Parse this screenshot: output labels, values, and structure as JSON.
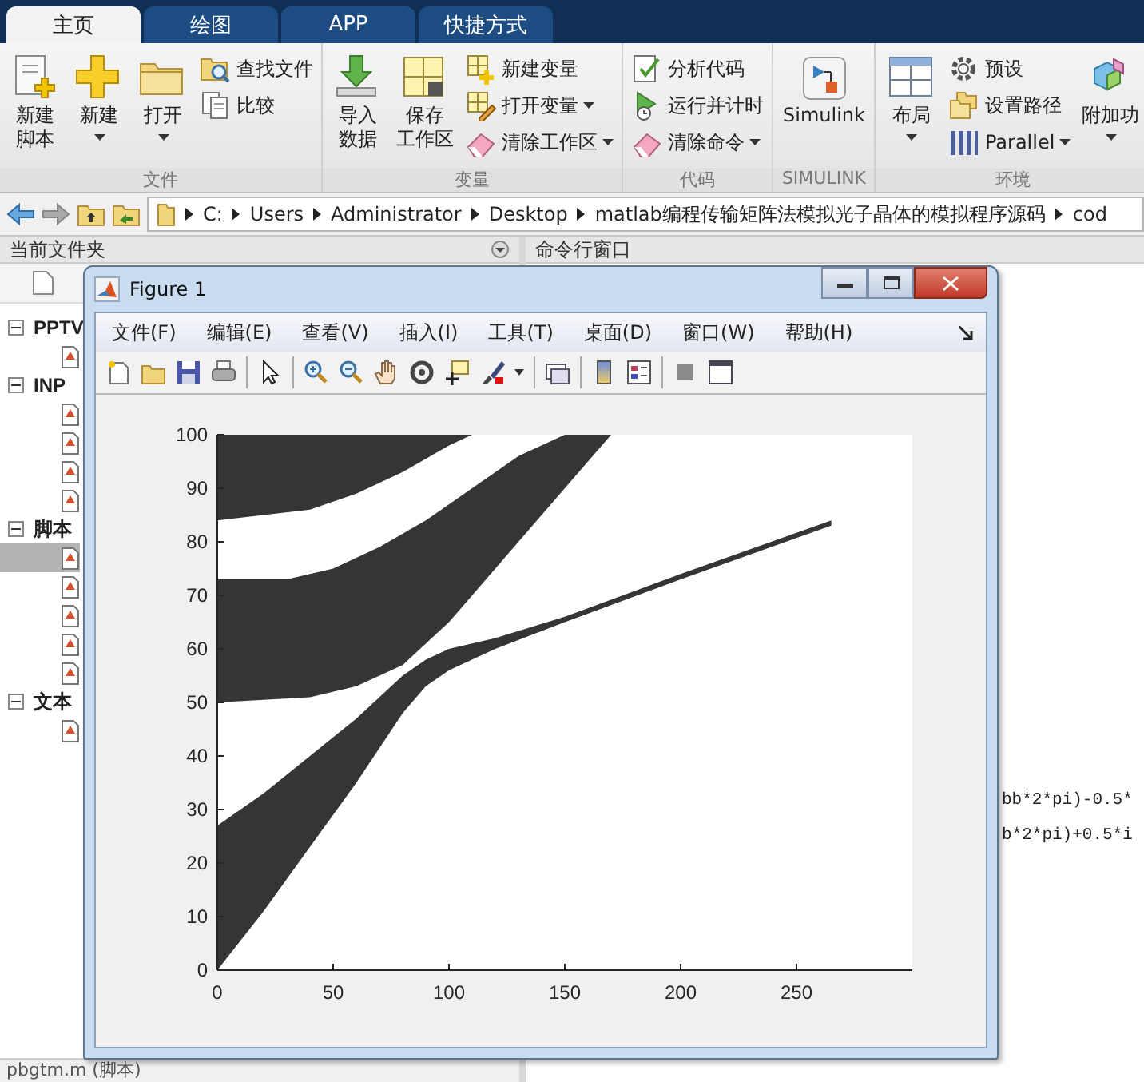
{
  "tabs": [
    {
      "label": "主页",
      "selected": true
    },
    {
      "label": "绘图",
      "selected": false
    },
    {
      "label": "APP",
      "selected": false
    },
    {
      "label": "快捷方式",
      "selected": false
    }
  ],
  "toolstrip": {
    "groups": [
      {
        "label": "文件",
        "items": [
          {
            "kind": "large",
            "lines": [
              "新建",
              "脚本"
            ],
            "dropdown": false
          },
          {
            "kind": "large",
            "lines": [
              "新建"
            ],
            "dropdown": true
          },
          {
            "kind": "large",
            "lines": [
              "打开"
            ],
            "dropdown": true
          },
          {
            "kind": "small",
            "lines": [
              "查找文件"
            ],
            "dropdown": false
          },
          {
            "kind": "small",
            "lines": [
              "比较"
            ],
            "dropdown": false
          }
        ]
      },
      {
        "label": "变量",
        "items": [
          {
            "kind": "large",
            "lines": [
              "导入",
              "数据"
            ],
            "dropdown": false
          },
          {
            "kind": "large",
            "lines": [
              "保存",
              "工作区"
            ],
            "dropdown": false
          },
          {
            "kind": "small",
            "lines": [
              "新建变量"
            ],
            "dropdown": false
          },
          {
            "kind": "small",
            "lines": [
              "打开变量"
            ],
            "dropdown": true
          },
          {
            "kind": "small",
            "lines": [
              "清除工作区"
            ],
            "dropdown": true
          }
        ]
      },
      {
        "label": "代码",
        "items": [
          {
            "kind": "small",
            "lines": [
              "分析代码"
            ],
            "dropdown": false
          },
          {
            "kind": "small",
            "lines": [
              "运行并计时"
            ],
            "dropdown": false
          },
          {
            "kind": "small",
            "lines": [
              "清除命令"
            ],
            "dropdown": true
          }
        ]
      },
      {
        "label": "SIMULINK",
        "items": [
          {
            "kind": "large",
            "lines": [
              "Simulink"
            ],
            "dropdown": false
          }
        ]
      },
      {
        "label": "环境",
        "items": [
          {
            "kind": "large",
            "lines": [
              "布局"
            ],
            "dropdown": true
          },
          {
            "kind": "small",
            "lines": [
              "预设"
            ],
            "dropdown": false
          },
          {
            "kind": "small",
            "lines": [
              "设置路径"
            ],
            "dropdown": false
          },
          {
            "kind": "small",
            "lines": [
              "Parallel"
            ],
            "dropdown": true
          },
          {
            "kind": "large",
            "lines": [
              "附加功"
            ],
            "dropdown": true
          }
        ]
      }
    ]
  },
  "address_bar": {
    "path": [
      "C:",
      "Users",
      "Administrator",
      "Desktop",
      "matlab编程传输矩阵法模拟光子晶体的模拟程序源码",
      "cod"
    ]
  },
  "current_folder": {
    "title": "当前文件夹",
    "sections": [
      {
        "label": "PPTV",
        "expanded": true,
        "children": [
          {
            "selected": false
          }
        ]
      },
      {
        "label": "INP",
        "expanded": true,
        "children": [
          {
            "selected": false
          },
          {
            "selected": false
          },
          {
            "selected": false
          },
          {
            "selected": false
          }
        ]
      },
      {
        "label": "脚本",
        "expanded": true,
        "children": [
          {
            "selected": true
          },
          {
            "selected": false
          },
          {
            "selected": false
          },
          {
            "selected": false
          },
          {
            "selected": false
          }
        ]
      },
      {
        "label": "文本",
        "expanded": true,
        "children": [
          {
            "selected": false
          }
        ]
      }
    ],
    "status": "pbgtm.m (脚本)"
  },
  "command_window": {
    "title": "命令行窗口",
    "lines": [
      "bb*2*pi)-0.5*",
      "b*2*pi)+0.5*i"
    ]
  },
  "figure": {
    "title": "Figure 1",
    "menu": [
      "文件(F)",
      "编辑(E)",
      "查看(V)",
      "插入(I)",
      "工具(T)",
      "桌面(D)",
      "窗口(W)",
      "帮助(H)"
    ],
    "axes": {
      "yticks": [
        "100",
        "90",
        "80",
        "70",
        "60",
        "50",
        "40",
        "30",
        "20",
        "10",
        "0"
      ],
      "xticks": [
        "0",
        "50",
        "100",
        "150",
        "200",
        "250"
      ]
    }
  }
}
